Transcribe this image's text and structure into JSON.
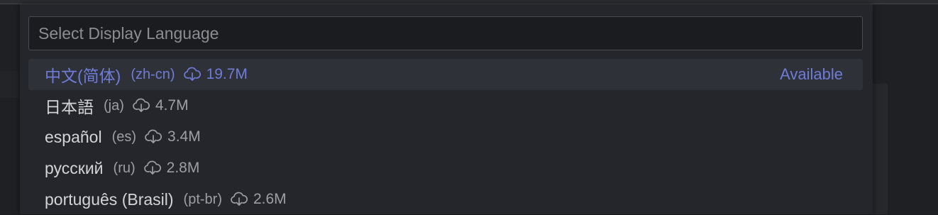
{
  "quick_pick": {
    "placeholder": "Select Display Language",
    "value": ""
  },
  "languages": [
    {
      "name": "中文(简体)",
      "code": "(zh-cn)",
      "icon": "cloud-download-icon",
      "size": "19.7M",
      "status": "Available",
      "selected": true
    },
    {
      "name": "日本語",
      "code": "(ja)",
      "icon": "cloud-download-icon",
      "size": "4.7M",
      "status": "",
      "selected": false
    },
    {
      "name": "español",
      "code": "(es)",
      "icon": "cloud-download-icon",
      "size": "3.4M",
      "status": "",
      "selected": false
    },
    {
      "name": "русский",
      "code": "(ru)",
      "icon": "cloud-download-icon",
      "size": "2.8M",
      "status": "",
      "selected": false
    },
    {
      "name": "português (Brasil)",
      "code": "(pt-br)",
      "icon": "cloud-download-icon",
      "size": "2.6M",
      "status": "",
      "selected": false
    }
  ],
  "colors": {
    "accent": "#6e7cd8",
    "background": "#24262b",
    "selected_row": "#2f3138",
    "text": "#d4d4d6",
    "muted_text": "#9d9fa4"
  }
}
